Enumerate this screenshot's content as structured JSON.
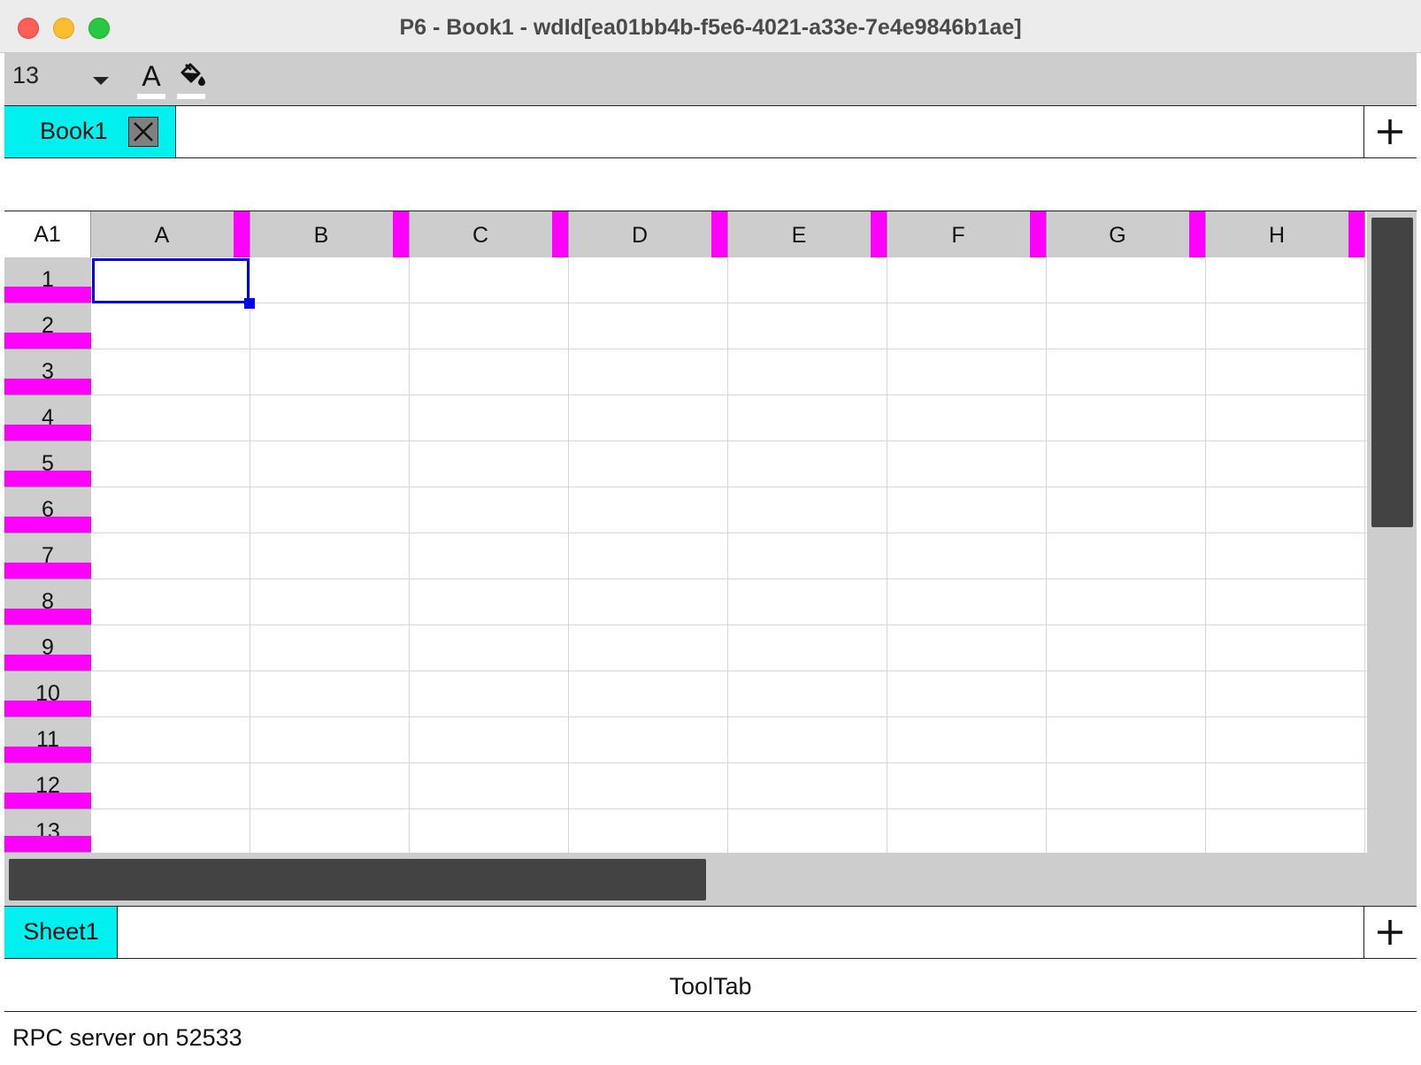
{
  "window": {
    "title": "P6 - Book1 - wdId[ea01bb4b-f5e6-4021-a33e-7e4e9846b1ae]"
  },
  "toolbar": {
    "font_size": "13",
    "font_color_icon": "text-color-icon",
    "fill_icon": "fill-color-icon"
  },
  "book_tabs": [
    {
      "label": "Book1",
      "active": true
    }
  ],
  "grid": {
    "selected_cell": "A1",
    "columns": [
      "A",
      "B",
      "C",
      "D",
      "E",
      "F",
      "G",
      "H"
    ],
    "rows": [
      "1",
      "2",
      "3",
      "4",
      "5",
      "6",
      "7",
      "8",
      "9",
      "10",
      "11",
      "12",
      "13"
    ]
  },
  "sheet_tabs": [
    {
      "label": "Sheet1",
      "active": true
    }
  ],
  "tooltab": {
    "label": "ToolTab"
  },
  "status": {
    "text": "RPC server on 52533"
  },
  "colors": {
    "active_tab": "#00f0f0",
    "header_marker": "#ff00ff",
    "selection": "#0000dd",
    "header_bg": "#cdcdcd"
  }
}
